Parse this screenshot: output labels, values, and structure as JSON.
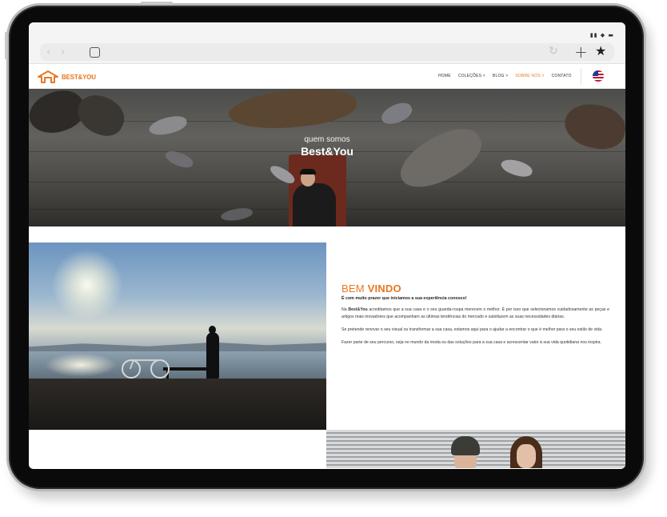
{
  "nav": {
    "logo_text": "BEST&YOU",
    "items": [
      {
        "label": "HOME"
      },
      {
        "label": "COLEÇÕES ˅"
      },
      {
        "label": "BLOG ˅"
      },
      {
        "label": "SOBRE NÓS ˅"
      },
      {
        "label": "CONTATO"
      }
    ],
    "active_index": 3,
    "language_icon": "us-flag-icon"
  },
  "browser": {
    "icons": [
      "back-arrow-icon",
      "forward-arrow-icon",
      "tabs-icon",
      "reload-icon",
      "new-tab-plus-icon",
      "bookmark-star-icon"
    ]
  },
  "hero": {
    "subtitle": "quem somos",
    "title": "Best&You"
  },
  "welcome": {
    "heading_light": "BEM ",
    "heading_bold": "VINDO",
    "intro": "É com muito prazer que iniciamos a sua experiência conosco!",
    "p1_lead": "Na ",
    "p1_brand": "Best&You",
    "p1_rest": " acreditamos que a sua casa e o seu guarda-roupa merecem o melhor. É por isso que selecionamos cuidadosamente as peças e artigos mais inovadores que acompanham as últimas tendências do mercado e satisfazem as suas necessidades diárias.",
    "p2": "Se pretende renovar o seu visual ou transformar a sua casa, estamos aqui para o ajudar a encontrar o que é melhor para o seu estilo de vida.",
    "p3": "Fazer parte de seu percurso, seja no mundo da moda ou das soluções para a sua casa e acrescentar valor à sua vida quotidiana nos inspira."
  },
  "colors": {
    "accent": "#e87722",
    "tablet_frame": "#0a0a0a"
  }
}
